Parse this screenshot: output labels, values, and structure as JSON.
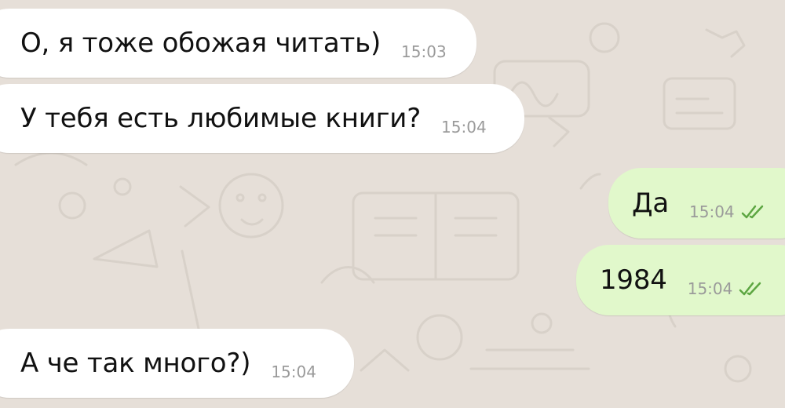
{
  "messages": [
    {
      "text": "О, я тоже обожая читать)",
      "time": "15:03",
      "direction": "incoming"
    },
    {
      "text": "У тебя есть любимые книги?",
      "time": "15:04",
      "direction": "incoming"
    },
    {
      "text": "Да",
      "time": "15:04",
      "direction": "outgoing",
      "status_icon": "double-check-icon"
    },
    {
      "text": "1984",
      "time": "15:04",
      "direction": "outgoing",
      "status_icon": "double-check-icon"
    },
    {
      "text": "А че так много?)",
      "time": "15:04",
      "direction": "incoming"
    }
  ],
  "colors": {
    "background": "#e6dfd8",
    "incoming_bubble": "#ffffff",
    "outgoing_bubble": "#e1f8cb",
    "read_check": "#5da642"
  }
}
